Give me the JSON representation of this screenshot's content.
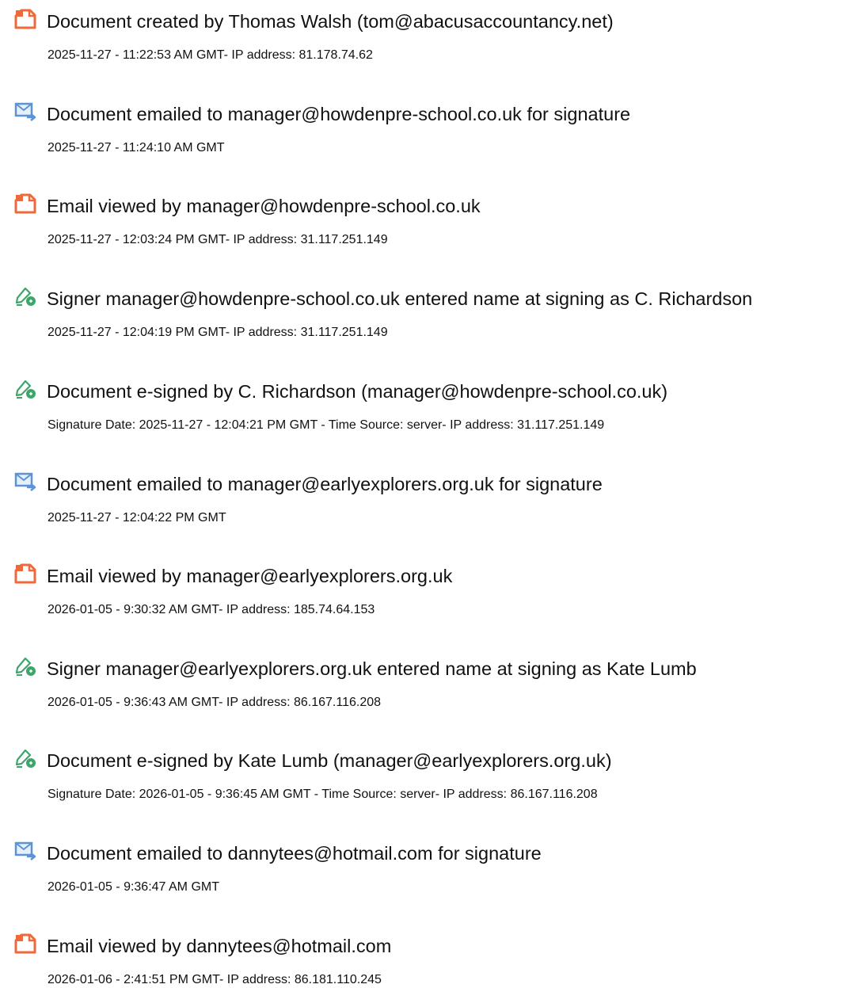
{
  "events": [
    {
      "icon": "document-icon",
      "title": "Document created by Thomas Walsh (tom@abacusaccountancy.net)",
      "detail": "2025-11-27 - 11:22:53 AM GMT- IP address: 81.178.74.62"
    },
    {
      "icon": "email-send-icon",
      "title": "Document emailed to manager@howdenpre-school.co.uk for signature",
      "detail": "2025-11-27 - 11:24:10 AM GMT"
    },
    {
      "icon": "document-icon",
      "title": "Email viewed by manager@howdenpre-school.co.uk",
      "detail": "2025-11-27 - 12:03:24 PM GMT- IP address: 31.117.251.149"
    },
    {
      "icon": "pen-sign-icon",
      "title": "Signer manager@howdenpre-school.co.uk entered name at signing as C. Richardson",
      "detail": "2025-11-27 - 12:04:19 PM GMT- IP address: 31.117.251.149"
    },
    {
      "icon": "pen-sign-icon",
      "title": "Document e-signed by C. Richardson (manager@howdenpre-school.co.uk)",
      "detail": "Signature Date: 2025-11-27 - 12:04:21 PM GMT - Time Source: server- IP address: 31.117.251.149"
    },
    {
      "icon": "email-send-icon",
      "title": "Document emailed to manager@earlyexplorers.org.uk for signature",
      "detail": "2025-11-27 - 12:04:22 PM GMT"
    },
    {
      "icon": "document-icon",
      "title": "Email viewed by manager@earlyexplorers.org.uk",
      "detail": "2026-01-05 - 9:30:32 AM GMT- IP address: 185.74.64.153"
    },
    {
      "icon": "pen-sign-icon",
      "title": "Signer manager@earlyexplorers.org.uk entered name at signing as Kate Lumb",
      "detail": "2026-01-05 - 9:36:43 AM GMT- IP address: 86.167.116.208"
    },
    {
      "icon": "pen-sign-icon",
      "title": "Document e-signed by Kate Lumb (manager@earlyexplorers.org.uk)",
      "detail": "Signature Date: 2026-01-05 - 9:36:45 AM GMT - Time Source: server- IP address: 86.167.116.208"
    },
    {
      "icon": "email-send-icon",
      "title": "Document emailed to dannytees@hotmail.com for signature",
      "detail": "2026-01-05 - 9:36:47 AM GMT"
    },
    {
      "icon": "document-icon",
      "title": "Email viewed by dannytees@hotmail.com",
      "detail": "2026-01-06 - 2:41:51 PM GMT- IP address: 86.181.110.245"
    }
  ],
  "colors": {
    "document_icon": "#EE6A3A",
    "email_icon": "#5B93D6",
    "pen_icon": "#3FA66B",
    "text": "#111111"
  }
}
